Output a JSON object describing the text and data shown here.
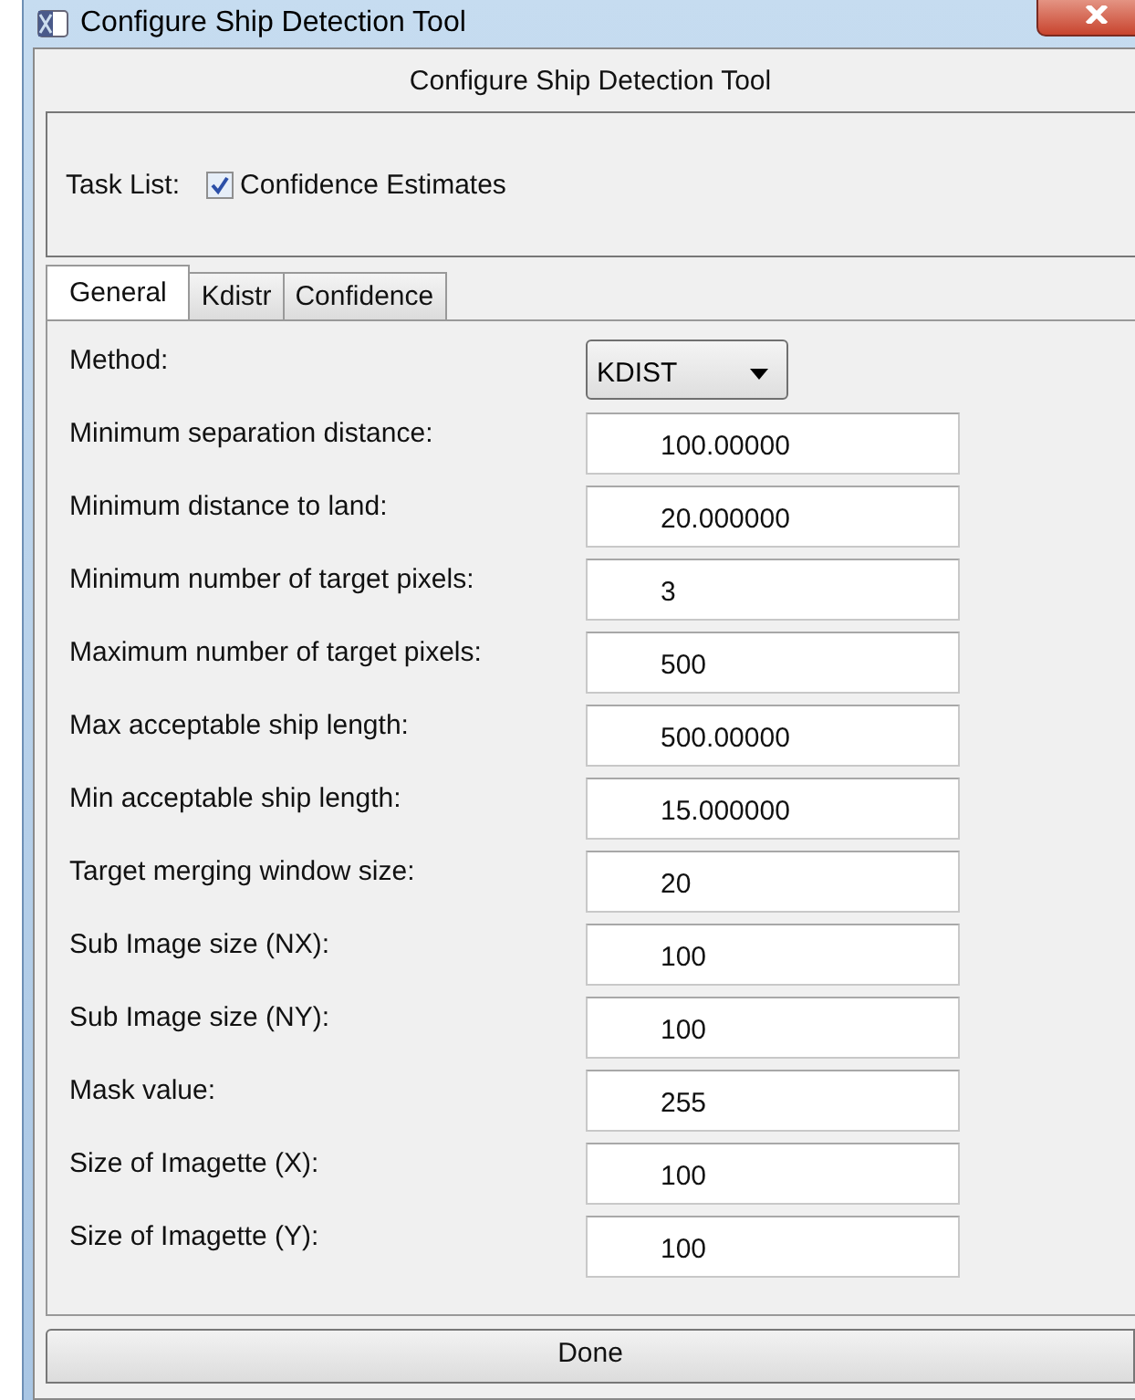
{
  "window": {
    "title": "Configure Ship Detection Tool"
  },
  "panel_title": "Configure Ship Detection Tool",
  "task_list": {
    "label": "Task List:",
    "items": [
      {
        "label": "Confidence Estimates",
        "checked": true
      }
    ]
  },
  "tabs": [
    {
      "label": "General",
      "selected": true
    },
    {
      "label": "Kdistr",
      "selected": false
    },
    {
      "label": "Confidence",
      "selected": false
    }
  ],
  "fields": [
    {
      "label": "Method:",
      "kind": "dropdown",
      "value": "KDIST"
    },
    {
      "label": "Minimum separation distance:",
      "kind": "text",
      "value": "100.00000"
    },
    {
      "label": "Minimum distance to land:",
      "kind": "text",
      "value": "20.000000"
    },
    {
      "label": "Minimum number of target pixels:",
      "kind": "text",
      "value": "3"
    },
    {
      "label": "Maximum number of target pixels:",
      "kind": "text",
      "value": "500"
    },
    {
      "label": "Max acceptable ship length:",
      "kind": "text",
      "value": "500.00000"
    },
    {
      "label": "Min acceptable ship length:",
      "kind": "text",
      "value": "15.000000"
    },
    {
      "label": "Target merging window size:",
      "kind": "text",
      "value": "20"
    },
    {
      "label": "Sub Image size (NX):",
      "kind": "text",
      "value": "100"
    },
    {
      "label": "Sub Image size (NY):",
      "kind": "text",
      "value": "100"
    },
    {
      "label": "Mask value:",
      "kind": "text",
      "value": "255"
    },
    {
      "label": "Size of Imagette (X):",
      "kind": "text",
      "value": "100"
    },
    {
      "label": "Size of Imagette (Y):",
      "kind": "text",
      "value": "100"
    }
  ],
  "buttons": [
    "Done"
  ]
}
